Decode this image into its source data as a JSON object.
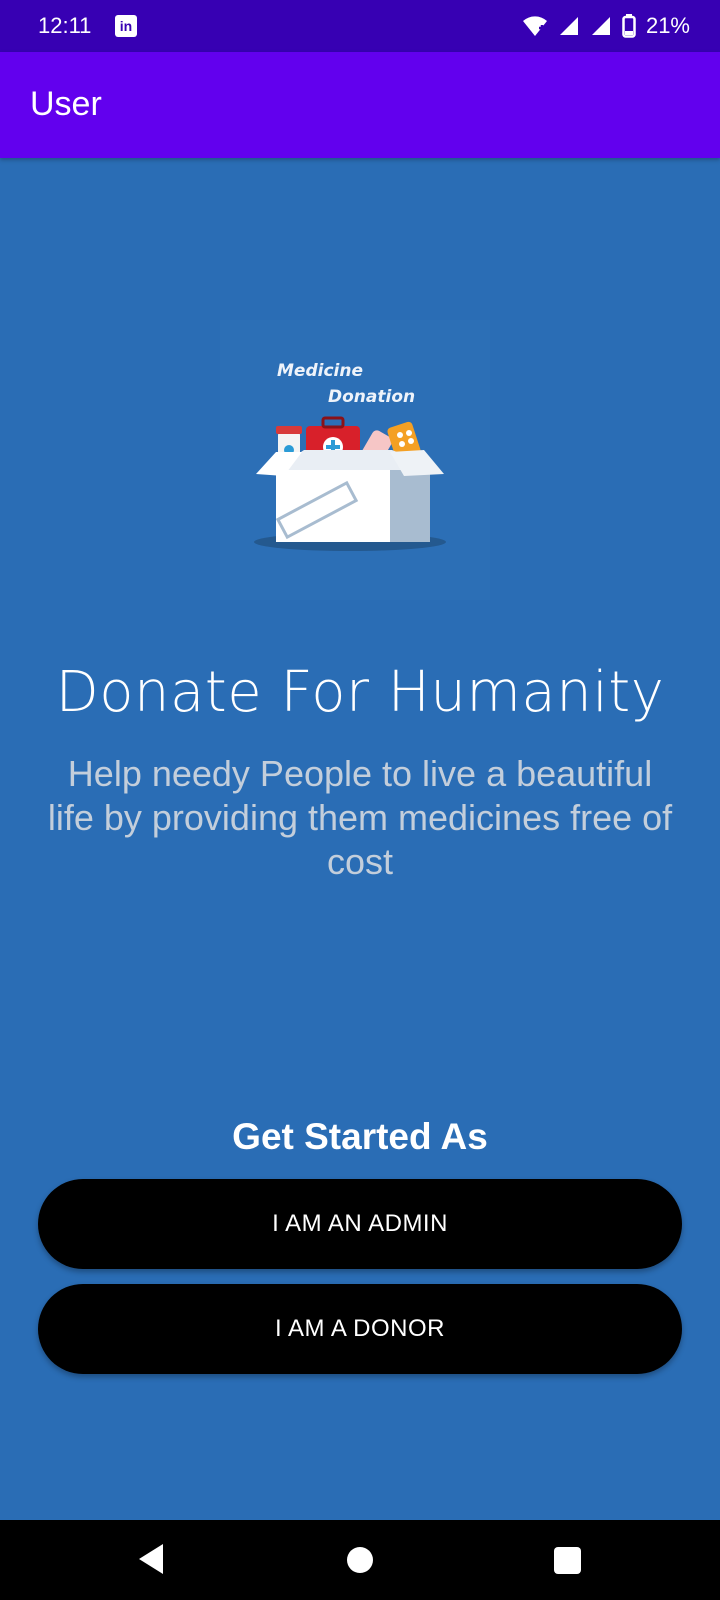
{
  "status_bar": {
    "time": "12:11",
    "battery_percent": "21%",
    "icons": [
      "linkedin-icon",
      "wifi-icon",
      "signal-icon",
      "signal-icon",
      "battery-icon"
    ]
  },
  "app_bar": {
    "title": "User"
  },
  "logo": {
    "line1": "Medicine",
    "line2": "Donation"
  },
  "main": {
    "headline": "Donate For Humanity",
    "tagline": "Help needy People to live a beautiful life by providing them medicines free of cost"
  },
  "actions": {
    "heading": "Get Started As",
    "admin_button": "I AM AN ADMIN",
    "donor_button": "I AM A DONOR"
  },
  "colors": {
    "status_bar": "#3700b3",
    "app_bar": "#6200ee",
    "background": "#2a6db5",
    "button": "#000000"
  },
  "nav": {
    "icons": [
      "back-icon",
      "home-icon",
      "recents-icon"
    ]
  }
}
